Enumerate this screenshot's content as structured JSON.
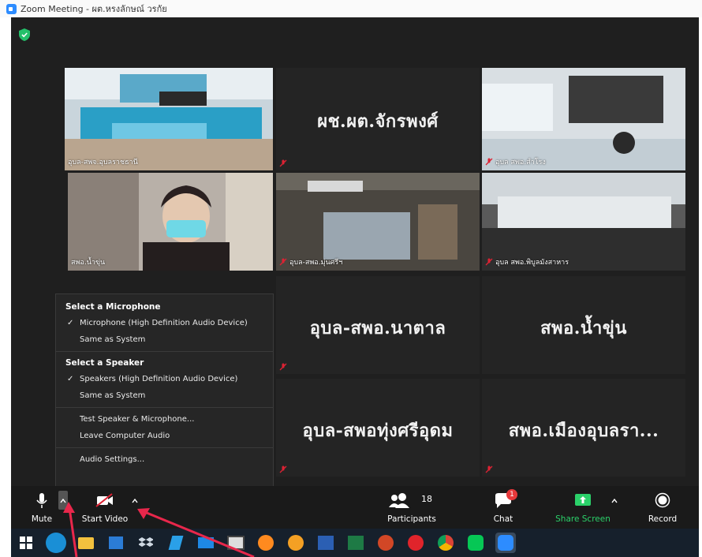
{
  "window": {
    "title": "Zoom Meeting - ผต.หรงลักษณ์ วรกัย"
  },
  "tiles": [
    {
      "name": "อุบล-สพจ.อุบลราชธานี",
      "type": "video"
    },
    {
      "name": "ผช.ผต.จักรพงศ์",
      "type": "name"
    },
    {
      "name": "อุบล สพอ.สำโรง",
      "type": "video"
    },
    {
      "name": "สพอ.น้ำขุ่น",
      "type": "video"
    },
    {
      "name": "อุบล-สพอ.มุ่นศรีฯ",
      "type": "video"
    },
    {
      "name": "อุบล สพอ.พิบูลมังสาหาร",
      "type": "video"
    },
    {
      "name": "อุบล-สพอ.นาตาล",
      "type": "name"
    },
    {
      "name": "สพอ.น้ำขุ่น",
      "type": "name"
    },
    {
      "name": "อุบล-สพอทุ่งศรีอุดม",
      "type": "name"
    },
    {
      "name": "สพอ.เมืองอุบลรา...",
      "type": "name"
    }
  ],
  "audio_menu": {
    "microphone_header": "Select a Microphone",
    "microphone_items": [
      "Microphone (High Definition Audio Device)",
      "Same as System"
    ],
    "speaker_header": "Select a Speaker",
    "speaker_items": [
      "Speakers (High Definition Audio Device)",
      "Same as System"
    ],
    "test": "Test Speaker & Microphone...",
    "leave": "Leave Computer Audio",
    "settings": "Audio Settings..."
  },
  "toolbar": {
    "mute": "Mute",
    "start_video": "Start Video",
    "participants": "Participants",
    "participants_count": "18",
    "chat": "Chat",
    "chat_badge": "1",
    "share": "Share Screen",
    "record": "Record"
  },
  "colors": {
    "accent": "#2d8cff",
    "share_green": "#2bd16a",
    "active_border": "#c8d84a",
    "badge_red": "#e8393b"
  }
}
